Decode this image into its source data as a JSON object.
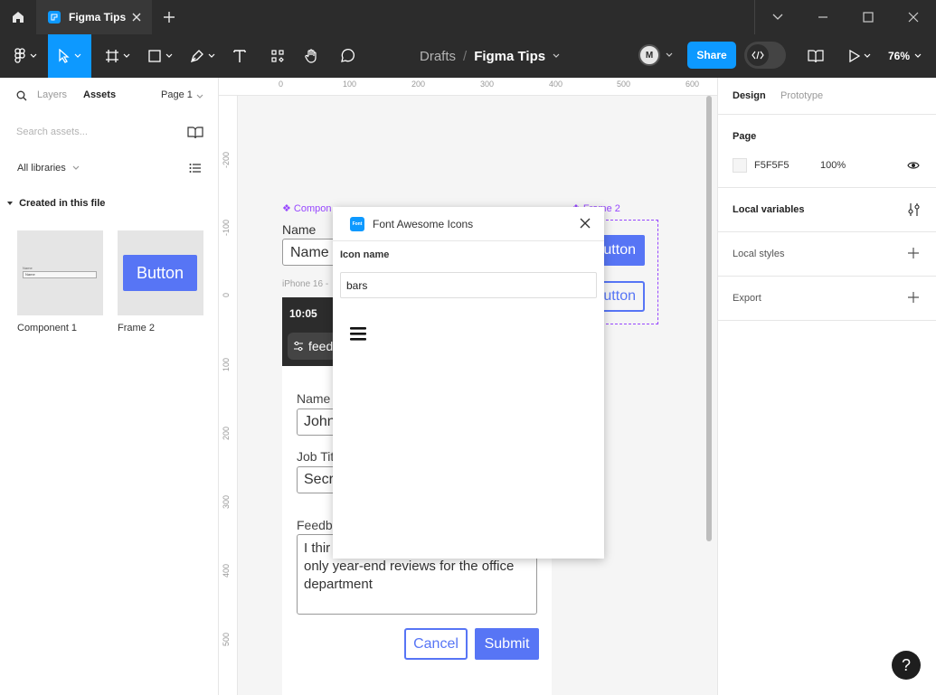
{
  "titlebar": {
    "tab_label": "Figma Tips"
  },
  "toolbar": {
    "breadcrumb_parent": "Drafts",
    "breadcrumb_separator": "/",
    "file_name": "Figma Tips",
    "avatar_initials": "M",
    "share_label": "Share",
    "zoom": "76%"
  },
  "left_panel": {
    "tabs": [
      "Layers",
      "Assets"
    ],
    "page_selector": "Page 1",
    "search_placeholder": "Search assets...",
    "libraries": "All libraries",
    "section_title": "Created in this file",
    "assets": [
      {
        "label": "Component 1",
        "thumb_field_label": "Name",
        "thumb_field_value": "Name"
      },
      {
        "label": "Frame 2",
        "thumb_button": "Button"
      }
    ]
  },
  "rulers": {
    "top": [
      "0",
      "100",
      "200",
      "300",
      "400",
      "500",
      "600"
    ],
    "left": [
      "-200",
      "-100",
      "0",
      "100",
      "200",
      "300",
      "400",
      "500"
    ]
  },
  "canvas": {
    "component1_label": "❖ Compon",
    "component1_field_label": "Name",
    "component1_field_value": "Name",
    "frame2_label": "❖ Frame 2",
    "frame2_btn1": "utton",
    "frame2_btn2": "utton",
    "iphone_label": "iPhone 16 -",
    "phone": {
      "time": "10:05",
      "chip_text": "feed",
      "name_label": "Name",
      "name_value": "John",
      "job_label": "Job Tit",
      "job_value": "Secre",
      "feedback_label": "Feedba",
      "feedback_text": "I thir quarterly reviews as opposed to only year-end reviews for the office department",
      "cancel_label": "Cancel",
      "submit_label": "Submit"
    }
  },
  "plugin": {
    "logo_text": "Font",
    "title": "Font Awesome Icons",
    "field_label": "Icon name",
    "field_value": "bars",
    "result_icon": "bars-icon"
  },
  "right_panel": {
    "tabs": [
      "Design",
      "Prototype"
    ],
    "page_title": "Page",
    "page_color": "F5F5F5",
    "page_opacity": "100%",
    "local_variables": "Local variables",
    "local_styles": "Local styles",
    "export": "Export"
  },
  "help": "?",
  "colors": {
    "accent": "#0d99ff",
    "chrome": "#2c2c2c",
    "component_purple": "#9747ff",
    "button_blue": "#5775f5"
  }
}
